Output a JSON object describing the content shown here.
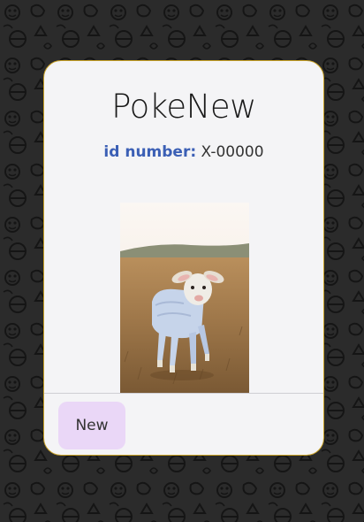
{
  "card": {
    "title": "PokeNew",
    "id_label": "id number:",
    "id_value": "X-00000",
    "image_alt": "Lamb wearing a light blue sweater standing in a field",
    "new_button_label": "New"
  },
  "colors": {
    "background": "#2b2b2b",
    "card_background": "#f4f4f6",
    "card_border": "#c9a227",
    "id_label": "#3b5fb5",
    "button_background": "#ead7f7"
  }
}
